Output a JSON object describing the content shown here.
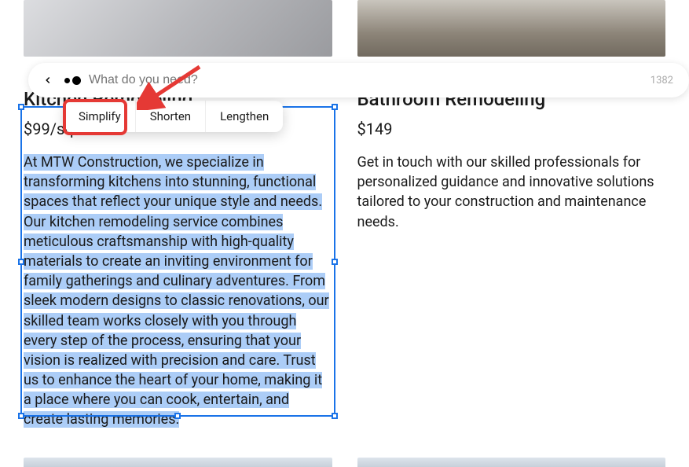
{
  "toolbar": {
    "placeholder": "What do you need?",
    "char_count": "1382"
  },
  "pills": {
    "simplify": "Simplify",
    "shorten": "Shorten",
    "lengthen": "Lengthen"
  },
  "cards": {
    "left": {
      "title": "Kitchen Remodeling",
      "price": "$99/sqft",
      "desc": "At MTW Construction, we specialize in transforming kitchens into stunning, functional spaces that reflect your unique style and needs. Our kitchen remodeling service combines meticulous craftsmanship with high-quality materials to create an inviting environment for family gatherings and culinary adventures. From sleek modern designs to classic renovations, our skilled team works closely with you through every step of the process, ensuring that your vision is realized with precision and care. Trust us to enhance the heart of your home, making it a place where you can cook, entertain, and create lasting memories."
    },
    "right": {
      "title": "Bathroom Remodeling",
      "price": "$149",
      "desc": "Get in touch with our skilled professionals for personalized guidance and innovative solutions tailored to your construction and maintenance needs."
    }
  }
}
